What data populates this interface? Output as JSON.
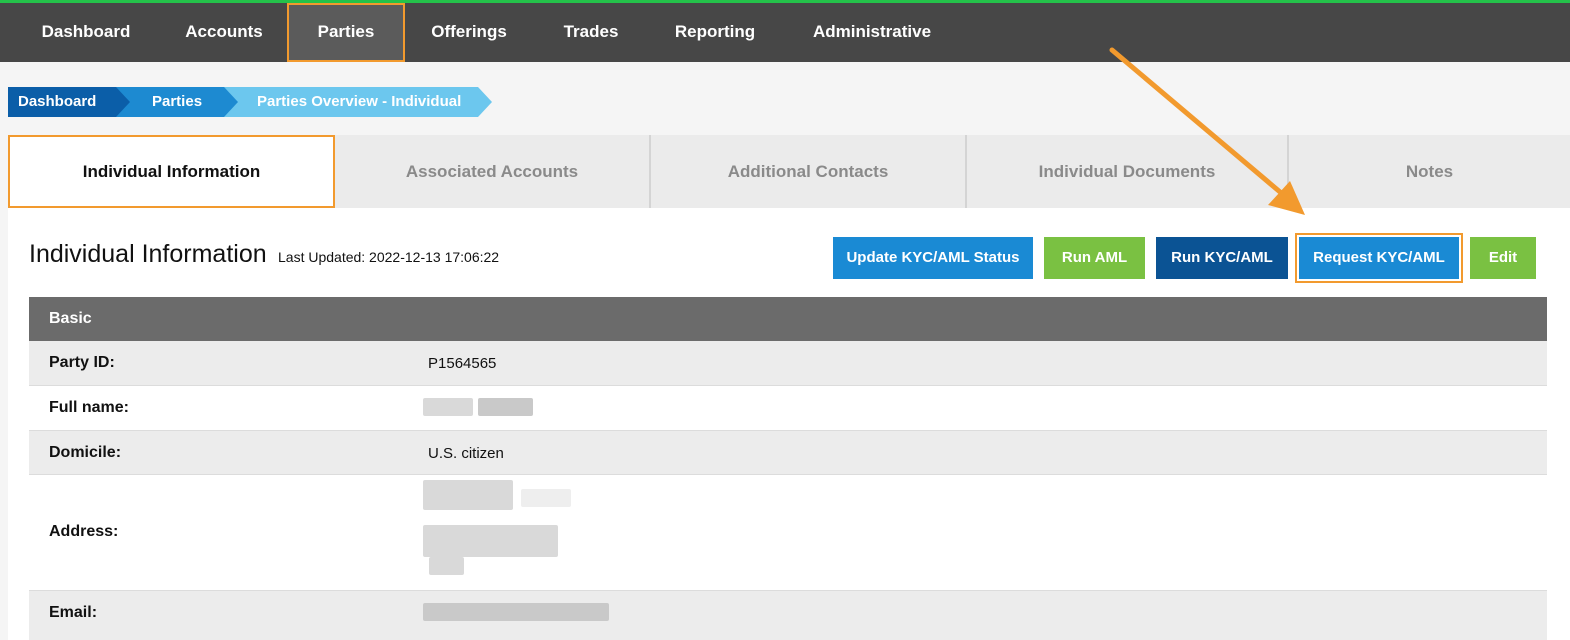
{
  "nav": {
    "items": [
      {
        "label": "Dashboard"
      },
      {
        "label": "Accounts"
      },
      {
        "label": "Parties"
      },
      {
        "label": "Offerings"
      },
      {
        "label": "Trades"
      },
      {
        "label": "Reporting"
      },
      {
        "label": "Administrative"
      }
    ],
    "active_index": 2
  },
  "breadcrumb": [
    "Dashboard",
    "Parties",
    "Parties Overview - Individual"
  ],
  "tabs": [
    {
      "label": "Individual Information"
    },
    {
      "label": "Associated Accounts"
    },
    {
      "label": "Additional Contacts"
    },
    {
      "label": "Individual Documents"
    },
    {
      "label": "Notes"
    }
  ],
  "panel": {
    "title": "Individual Information",
    "last_updated": "Last Updated: 2022-12-13 17:06:22"
  },
  "actions": {
    "update_kyc": "Update KYC/AML Status",
    "run_aml": "Run AML",
    "run_kyc": "Run KYC/AML",
    "request_kyc": "Request KYC/AML",
    "edit": "Edit"
  },
  "basic": {
    "heading": "Basic",
    "party_id_label": "Party ID:",
    "party_id_value": "P1564565",
    "full_name_label": "Full name:",
    "domicile_label": "Domicile:",
    "domicile_value": "U.S. citizen",
    "address_label": "Address:",
    "email_label": "Email:"
  },
  "colors": {
    "nav_bg": "#474747",
    "highlight": "#f29a2e",
    "accent_green": "#24c24a",
    "button_blue": "#1a8ad4",
    "button_green": "#7ac142",
    "button_navy": "#0b5394"
  }
}
